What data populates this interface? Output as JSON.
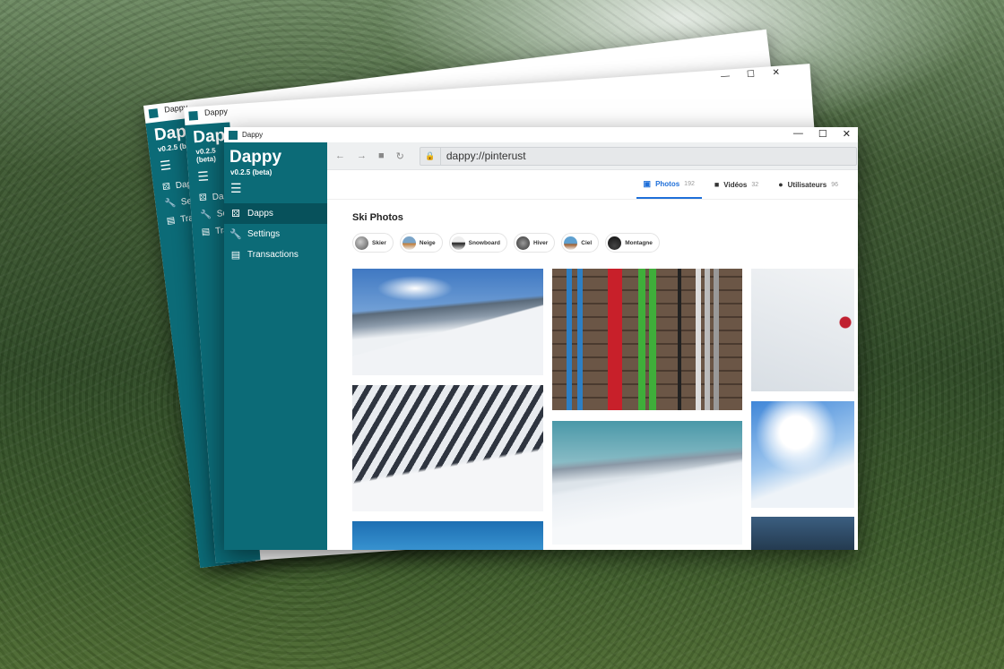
{
  "app": {
    "title": "Dappy",
    "version": "v0.2.5 (beta)"
  },
  "window": {
    "title_bar_text": "Dappy"
  },
  "sidebar": {
    "items": [
      {
        "label": "Dapps",
        "icon": "dice-icon"
      },
      {
        "label": "Settings",
        "icon": "wrench-icon"
      },
      {
        "label": "Transactions",
        "icon": "receipt-icon"
      }
    ],
    "back_items": [
      {
        "label": "Dapps"
      },
      {
        "label": "Settin"
      },
      {
        "label": "Transa"
      }
    ]
  },
  "toolbar": {
    "url": "dappy://pinterust"
  },
  "tabs": [
    {
      "label": "Photos",
      "count": "192",
      "icon": "image-icon"
    },
    {
      "label": "Vidéos",
      "count": "32",
      "icon": "video-icon"
    },
    {
      "label": "Utilisateurs",
      "count": "96",
      "icon": "user-icon"
    }
  ],
  "section": {
    "title": "Ski Photos"
  },
  "chips": [
    {
      "label": "Skier"
    },
    {
      "label": "Neige"
    },
    {
      "label": "Snowboard"
    },
    {
      "label": "Hiver"
    },
    {
      "label": "Ciel"
    },
    {
      "label": "Montagne"
    }
  ],
  "colors": {
    "sidebar": "#0c6b77",
    "sidebar_active": "#07515b",
    "accent": "#1e6fd9"
  }
}
